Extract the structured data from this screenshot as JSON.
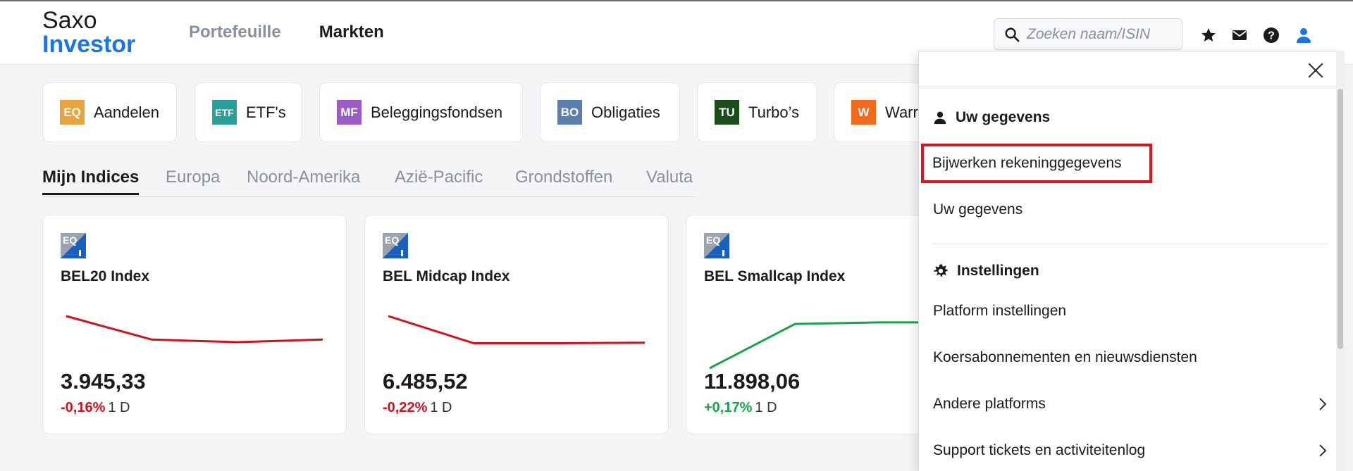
{
  "logo": {
    "line1": "Saxo",
    "line2": "Investor"
  },
  "nav": [
    {
      "label": "Portefeuille",
      "active": false
    },
    {
      "label": "Markten",
      "active": true
    }
  ],
  "search": {
    "placeholder": "Zoeken naam/ISIN",
    "value": ""
  },
  "header_icons": [
    "star-icon",
    "mail-icon",
    "help-icon",
    "user-icon"
  ],
  "chips": [
    {
      "badge": "EQ",
      "label": "Aandelen",
      "color": "#e8a33d"
    },
    {
      "badge": "ETF",
      "label": "ETF's",
      "color": "#2aa198"
    },
    {
      "badge": "MF",
      "label": "Beleggingsfondsen",
      "color": "#9c5cc7"
    },
    {
      "badge": "BO",
      "label": "Obligaties",
      "color": "#5b7eac"
    },
    {
      "badge": "TU",
      "label": "Turbo’s",
      "color": "#1a4d1a"
    },
    {
      "badge": "W",
      "label": "Warr",
      "color": "#f26b1d"
    }
  ],
  "tabs": [
    {
      "label": "Mijn Indices",
      "active": true
    },
    {
      "label": "Europa",
      "active": false
    },
    {
      "label": "Noord-Amerika",
      "active": false
    },
    {
      "label": "Azië-Pacific",
      "active": false
    },
    {
      "label": "Grondstoffen",
      "active": false
    },
    {
      "label": "Valuta",
      "active": false
    }
  ],
  "cards": [
    {
      "icon": "EQ",
      "name": "BEL20 Index",
      "price": "3.945,33",
      "change": "-0,16%",
      "period": "1 D",
      "direction": "down",
      "trend": [
        1.0,
        0.55,
        0.5,
        0.55
      ]
    },
    {
      "icon": "EQ",
      "name": "BEL Midcap Index",
      "price": "6.485,52",
      "change": "-0,22%",
      "period": "1 D",
      "direction": "down",
      "trend": [
        1.0,
        0.48,
        0.48,
        0.49
      ]
    },
    {
      "icon": "EQ",
      "name": "BEL Smallcap Index",
      "price": "11.898,06",
      "change": "+0,17%",
      "period": "1 D",
      "direction": "up",
      "trend": [
        0.0,
        0.85,
        0.88,
        0.88
      ]
    }
  ],
  "menu": {
    "section1_title": "Uw gegevens",
    "item_update": "Bijwerken rekeninggegevens",
    "item_details": "Uw gegevens",
    "section2_title": "Instellingen",
    "item_platform": "Platform instellingen",
    "item_subscriptions": "Koersabonnementen en nieuwsdiensten",
    "item_other_platforms": "Andere platforms",
    "item_support": "Support tickets en activiteitenlog"
  },
  "colors": {
    "accent": "#1b74e4",
    "negative": "#d4101e",
    "positive": "#16a34a",
    "highlight": "#e0141e"
  }
}
